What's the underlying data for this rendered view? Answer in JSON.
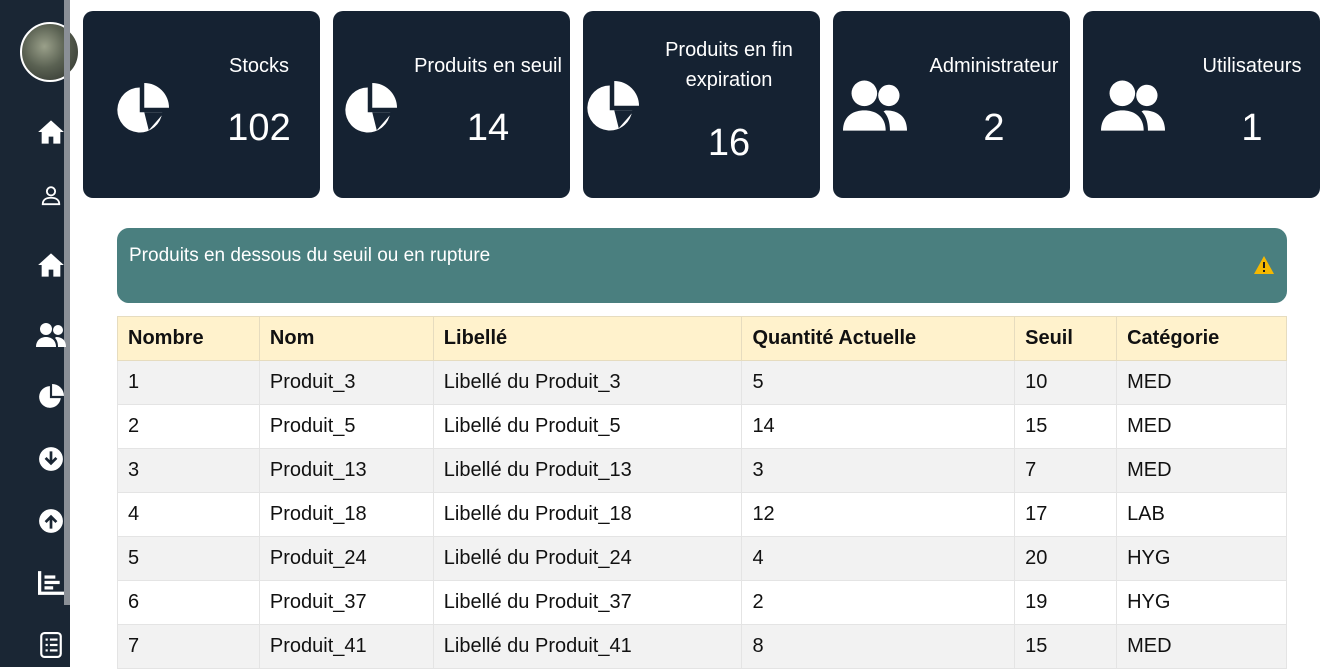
{
  "sidebar": {
    "icons": [
      "home-icon",
      "user-icon",
      "home-icon",
      "users-icon",
      "chart-pie-icon",
      "arrow-down-circle-icon",
      "arrow-up-circle-icon",
      "bar-chart-icon",
      "document-list-icon"
    ]
  },
  "cards": [
    {
      "label": "Stocks",
      "value": "102",
      "icon": "chart-pie-icon"
    },
    {
      "label": "Produits en seuil",
      "value": "14",
      "icon": "chart-pie-icon"
    },
    {
      "label": "Produits en fin expiration",
      "value": "16",
      "icon": "chart-pie-icon"
    },
    {
      "label": "Administrateur",
      "value": "2",
      "icon": "users-icon"
    },
    {
      "label": "Utilisateurs",
      "value": "1",
      "icon": "users-icon"
    }
  ],
  "banner": {
    "title": "Produits en dessous du seuil ou en rupture",
    "icon": "warning-icon",
    "color": "#4a7f7f"
  },
  "table": {
    "headers": [
      "Nombre",
      "Nom",
      "Libellé",
      "Quantité Actuelle",
      "Seuil",
      "Catégorie"
    ],
    "rows": [
      [
        "1",
        "Produit_3",
        "Libellé du Produit_3",
        "5",
        "10",
        "MED"
      ],
      [
        "2",
        "Produit_5",
        "Libellé du Produit_5",
        "14",
        "15",
        "MED"
      ],
      [
        "3",
        "Produit_13",
        "Libellé du Produit_13",
        "3",
        "7",
        "MED"
      ],
      [
        "4",
        "Produit_18",
        "Libellé du Produit_18",
        "12",
        "17",
        "LAB"
      ],
      [
        "5",
        "Produit_24",
        "Libellé du Produit_24",
        "4",
        "20",
        "HYG"
      ],
      [
        "6",
        "Produit_37",
        "Libellé du Produit_37",
        "2",
        "19",
        "HYG"
      ],
      [
        "7",
        "Produit_41",
        "Libellé du Produit_41",
        "8",
        "15",
        "MED"
      ]
    ]
  },
  "colors": {
    "sidebar": "#1a2634",
    "card": "#152232",
    "header": "#fff2cc",
    "warning": "#f5b800"
  }
}
